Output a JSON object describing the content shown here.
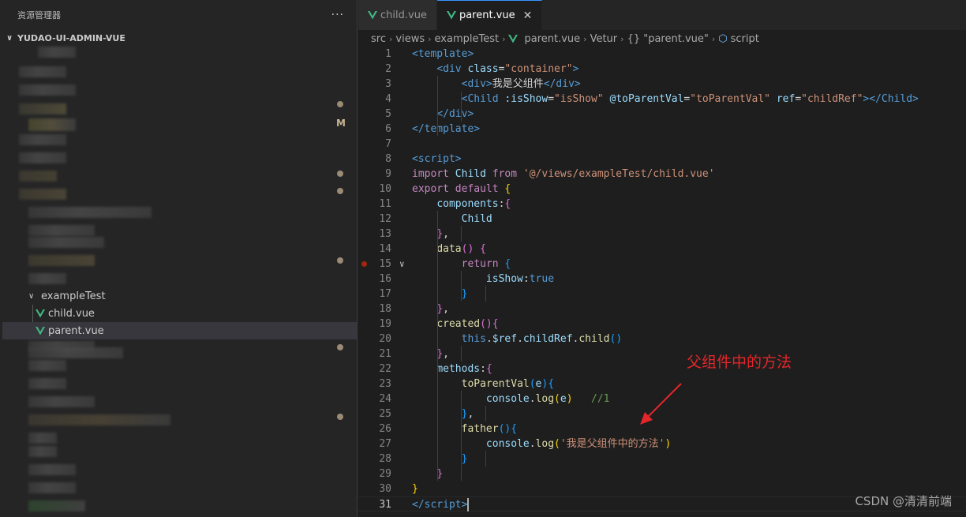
{
  "sidebar": {
    "title": "资源管理器",
    "more": "···",
    "project": "YUDAO-UI-ADMIN-VUE",
    "modified_marker": "M",
    "folder": "exampleTest",
    "files": [
      "child.vue",
      "parent.vue"
    ]
  },
  "tabs": [
    {
      "label": "child.vue",
      "active": false
    },
    {
      "label": "parent.vue",
      "active": true,
      "close": "✕"
    }
  ],
  "breadcrumb": [
    "src",
    "views",
    "exampleTest",
    "parent.vue",
    "Vetur",
    "{} \"parent.vue\"",
    "script"
  ],
  "code": {
    "line_numbers": [
      "1",
      "2",
      "3",
      "4",
      "5",
      "6",
      "7",
      "8",
      "9",
      "10",
      "11",
      "12",
      "13",
      "14",
      "15",
      "16",
      "17",
      "18",
      "19",
      "20",
      "21",
      "22",
      "23",
      "24",
      "25",
      "26",
      "27",
      "28",
      "29",
      "30",
      "31"
    ],
    "l3_text": "我是父组件",
    "l9_path": "'@/views/exampleTest/child.vue'",
    "l24_comment": "//1",
    "l27_string": "'我是父组件中的方法'"
  },
  "annotation": "父组件中的方法",
  "watermark": "CSDN @清清前端",
  "colors": {
    "vue_green": "#41b883",
    "annotation_red": "#e3262a",
    "tab_accent": "#3794ff"
  }
}
